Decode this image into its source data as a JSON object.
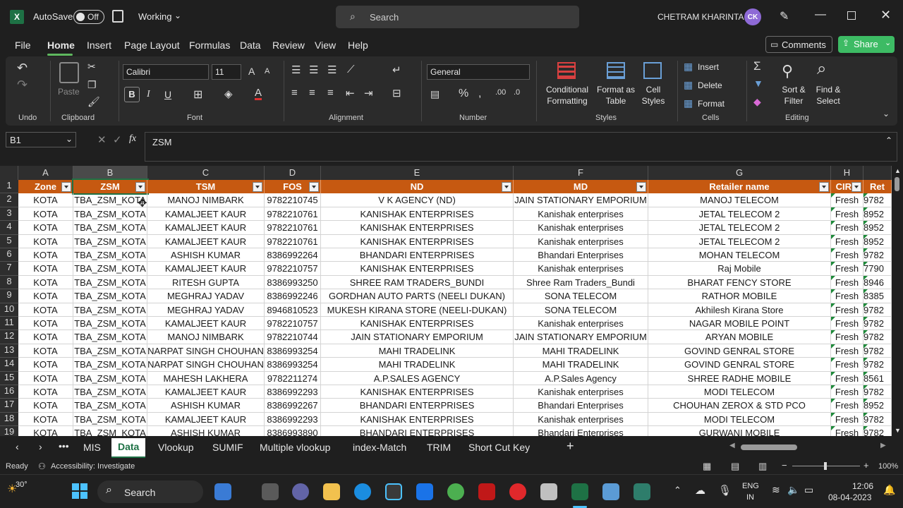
{
  "titlebar": {
    "autosave_label": "AutoSave",
    "autosave_state": "Off",
    "doc_status": "Working",
    "search_placeholder": "Search",
    "user_name": "CHETRAM KHARINTA",
    "user_initials": "CK"
  },
  "menu": {
    "items": [
      "File",
      "Home",
      "Insert",
      "Page Layout",
      "Formulas",
      "Data",
      "Review",
      "View",
      "Help"
    ],
    "comments_label": "Comments",
    "share_label": "Share"
  },
  "ribbon": {
    "groups": [
      "Undo",
      "Clipboard",
      "Font",
      "Alignment",
      "Number",
      "Styles",
      "Cells",
      "Editing"
    ],
    "paste_label": "Paste",
    "font_name": "Calibri",
    "font_size": "11",
    "number_format": "General",
    "conditional_formatting": [
      "Conditional",
      "Formatting"
    ],
    "format_as_table": [
      "Format as",
      "Table"
    ],
    "cell_styles": [
      "Cell",
      "Styles"
    ],
    "insert_label": "Insert",
    "delete_label": "Delete",
    "format_label": "Format",
    "sort_filter": [
      "Sort &",
      "Filter"
    ],
    "find_select": [
      "Find &",
      "Select"
    ]
  },
  "formula_bar": {
    "name_box": "B1",
    "content": "ZSM"
  },
  "sheet": {
    "columns": [
      "A",
      "B",
      "C",
      "D",
      "E",
      "F",
      "G",
      "H"
    ],
    "headers": [
      "Zone",
      "ZSM",
      "TSM",
      "FOS",
      "ND",
      "MD",
      "Retailer name",
      "CIRC",
      "Ret"
    ],
    "rows": [
      [
        "KOTA",
        "TBA_ZSM_KOTA",
        "MANOJ NIMBARK",
        "9782210745",
        "V K AGENCY (ND)",
        "JAIN STATIONARY EMPORIUM",
        "MANOJ TELECOM",
        "Fresh",
        "9782"
      ],
      [
        "KOTA",
        "TBA_ZSM_KOTA",
        "KAMALJEET KAUR",
        "9782210761",
        "KANISHAK ENTERPRISES",
        "Kanishak enterprises",
        "JETAL TELECOM 2",
        "Fresh",
        "8952"
      ],
      [
        "KOTA",
        "TBA_ZSM_KOTA",
        "KAMALJEET KAUR",
        "9782210761",
        "KANISHAK ENTERPRISES",
        "Kanishak enterprises",
        "JETAL TELECOM 2",
        "Fresh",
        "8952"
      ],
      [
        "KOTA",
        "TBA_ZSM_KOTA",
        "KAMALJEET KAUR",
        "9782210761",
        "KANISHAK ENTERPRISES",
        "Kanishak enterprises",
        "JETAL TELECOM 2",
        "Fresh",
        "8952"
      ],
      [
        "KOTA",
        "TBA_ZSM_KOTA",
        "ASHISH KUMAR",
        "8386992264",
        "BHANDARI ENTERPRISES",
        "Bhandari Enterprises",
        "MOHAN TELECOM",
        "Fresh",
        "9782"
      ],
      [
        "KOTA",
        "TBA_ZSM_KOTA",
        "KAMALJEET KAUR",
        "9782210757",
        "KANISHAK ENTERPRISES",
        "Kanishak enterprises",
        "Raj Mobile",
        "Fresh",
        "7790"
      ],
      [
        "KOTA",
        "TBA_ZSM_KOTA",
        "RITESH GUPTA",
        "8386993250",
        "SHREE RAM TRADERS_BUNDI",
        "Shree Ram Traders_Bundi",
        "BHARAT FENCY STORE",
        "Fresh",
        "8946"
      ],
      [
        "KOTA",
        "TBA_ZSM_KOTA",
        "MEGHRAJ YADAV",
        "8386992246",
        "GORDHAN AUTO PARTS (NEELI DUKAN)",
        "SONA TELECOM",
        "RATHOR MOBILE",
        "Fresh",
        "8385"
      ],
      [
        "KOTA",
        "TBA_ZSM_KOTA",
        "MEGHRAJ YADAV",
        "8946810523",
        "MUKESH KIRANA STORE (NEELI-DUKAN)",
        "SONA TELECOM",
        "Akhilesh Kirana Store",
        "Fresh",
        "9782"
      ],
      [
        "KOTA",
        "TBA_ZSM_KOTA",
        "KAMALJEET KAUR",
        "9782210757",
        "KANISHAK ENTERPRISES",
        "Kanishak enterprises",
        "NAGAR MOBILE POINT",
        "Fresh",
        "9782"
      ],
      [
        "KOTA",
        "TBA_ZSM_KOTA",
        "MANOJ NIMBARK",
        "9782210744",
        "JAIN STATIONARY EMPORIUM",
        "JAIN STATIONARY EMPORIUM",
        "ARYAN MOBILE",
        "Fresh",
        "9782"
      ],
      [
        "KOTA",
        "TBA_ZSM_KOTA",
        "NARPAT SINGH CHOUHAN",
        "8386993254",
        "MAHI TRADELINK",
        "MAHI TRADELINK",
        "GOVIND GENRAL STORE",
        "Fresh",
        "9782"
      ],
      [
        "KOTA",
        "TBA_ZSM_KOTA",
        "NARPAT SINGH CHOUHAN",
        "8386993254",
        "MAHI TRADELINK",
        "MAHI TRADELINK",
        "GOVIND GENRAL STORE",
        "Fresh",
        "9782"
      ],
      [
        "KOTA",
        "TBA_ZSM_KOTA",
        "MAHESH LAKHERA",
        "9782211274",
        "A.P.SALES AGENCY",
        "A.P.Sales Agency",
        "SHREE RADHE MOBILE",
        "Fresh",
        "8561"
      ],
      [
        "KOTA",
        "TBA_ZSM_KOTA",
        "KAMALJEET KAUR",
        "8386992293",
        "KANISHAK ENTERPRISES",
        "Kanishak enterprises",
        "MODI TELECOM",
        "Fresh",
        "9782"
      ],
      [
        "KOTA",
        "TBA_ZSM_KOTA",
        "ASHISH KUMAR",
        "8386992267",
        "BHANDARI ENTERPRISES",
        "Bhandari Enterprises",
        "CHOUHAN ZEROX & STD PCO",
        "Fresh",
        "8952"
      ],
      [
        "KOTA",
        "TBA_ZSM_KOTA",
        "KAMALJEET KAUR",
        "8386992293",
        "KANISHAK ENTERPRISES",
        "Kanishak enterprises",
        "MODI TELECOM",
        "Fresh",
        "9782"
      ],
      [
        "KOTA",
        "TBA_ZSM_KOTA",
        "ASHISH KUMAR",
        "8386993890",
        "BHANDARI ENTERPRISES",
        "Bhandari Enterprises",
        "GURWANI MOBILE",
        "Fresh",
        "9782"
      ]
    ]
  },
  "tabs": {
    "items": [
      "MIS",
      "Data",
      "Vlookup",
      "SUMIF",
      "Multiple vlookup",
      "index-Match",
      "TRIM",
      "Short Cut Key"
    ],
    "active": "Data"
  },
  "status": {
    "ready": "Ready",
    "accessibility": "Accessibility: Investigate",
    "zoom": "100%"
  },
  "taskbar": {
    "weather": "30°",
    "search_label": "Search",
    "lang_line1": "ENG",
    "lang_line2": "IN",
    "time": "12:06",
    "date": "08-04-2023"
  },
  "colors": {
    "header_fill": "#c65911",
    "accent_green": "#1e7145",
    "share_green": "#3dbb64"
  }
}
